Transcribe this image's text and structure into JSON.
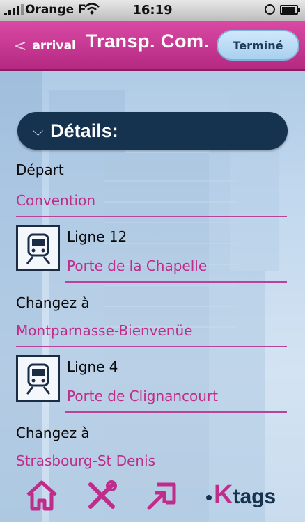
{
  "status": {
    "carrier": "Orange F",
    "time": "16:19",
    "battery_level": 0.9
  },
  "nav": {
    "back_label": "arrival",
    "title": "Transp. Com.",
    "done_label": "Terminé"
  },
  "details": {
    "header": "Détails:",
    "departure_label": "Départ",
    "departure_value": "Convention",
    "segments": [
      {
        "line": "Ligne 12",
        "destination": "Porte de la Chapelle",
        "change_label": "Changez à",
        "change_station": "Montparnasse-Bienvenüe"
      },
      {
        "line": "Ligne 4",
        "destination": "Porte de Clignancourt",
        "change_label": "Changez à",
        "change_station": "Strasbourg-St Denis"
      }
    ]
  },
  "tabbar": {
    "icons": [
      "home-icon",
      "tools-icon",
      "share-icon"
    ],
    "brand_k": "K",
    "brand_tags": "tags"
  },
  "colors": {
    "magenta": "#c02c8a",
    "navy": "#15324f",
    "nav_pink": "#d94aa3"
  }
}
